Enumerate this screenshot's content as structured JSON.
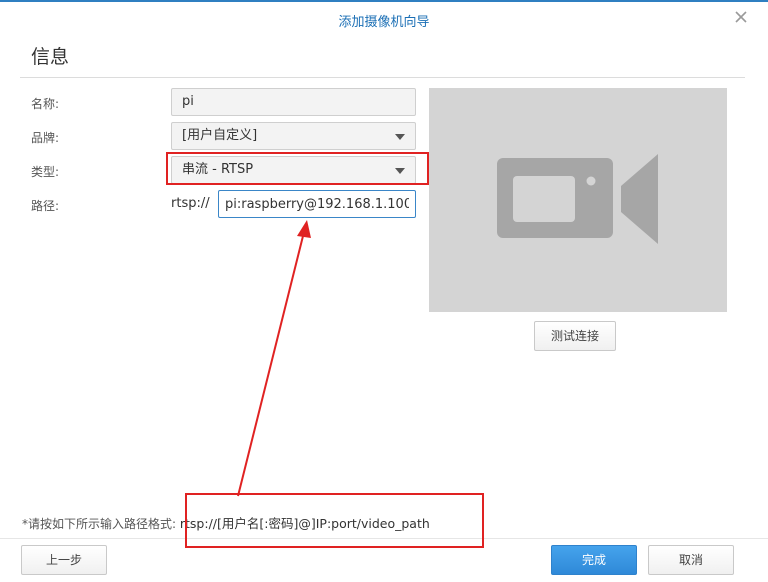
{
  "dialog": {
    "title": "添加摄像机向导",
    "section_title": "信息"
  },
  "form": {
    "name_label": "名称:",
    "name_value": "pi",
    "brand_label": "品牌:",
    "brand_value": "[用户自定义]",
    "type_label": "类型:",
    "type_value": "串流 - RTSP",
    "path_label": "路径:",
    "path_prefix": "rtsp://",
    "path_value": "pi:raspberry@192.168.1.100"
  },
  "preview": {
    "icon": "video-camera-icon",
    "test_button": "测试连接"
  },
  "hint": {
    "prefix": "*请按如下所示输入路径格式:",
    "format": "rtsp://[用户名[:密码]@]IP:port/video_path"
  },
  "footer": {
    "back_button": "上一步",
    "finish_button": "完成",
    "cancel_button": "取消"
  },
  "colors": {
    "accent": "#2f89d8",
    "title_blue": "#1b6fb5",
    "annotation_red": "#e02222"
  }
}
